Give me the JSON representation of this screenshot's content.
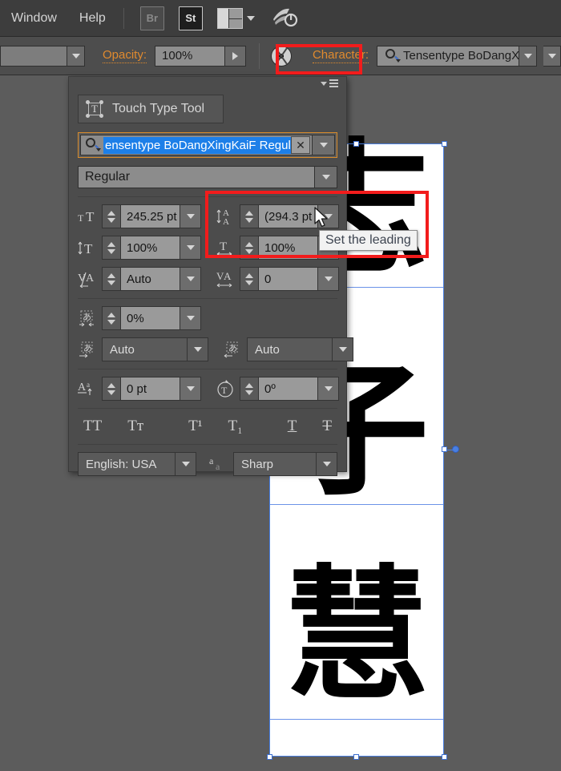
{
  "menubar": {
    "items": [
      {
        "label": "Window"
      },
      {
        "label": "Help"
      }
    ],
    "bridge_label": "Br",
    "stock_label": "St",
    "workspace_icon": "workspace-switcher-icon",
    "rocket_icon": "rocket-power-icon"
  },
  "controlbar": {
    "fill_swatch_name": "fill-color-swatch",
    "opacity_label": "Opacity:",
    "opacity_value": "100%",
    "recolor_icon": "recolor-artwork-icon",
    "character_label": "Character:",
    "font_name": "Tensentype BoDangXingK",
    "search_icon": "search-font-icon"
  },
  "character_panel": {
    "touch_type_tool": "Touch Type Tool",
    "font_search": {
      "value": "ensentype BoDangXingKaiF Regular",
      "clear_glyph": "✕",
      "icon": "search-icon"
    },
    "font_style": "Regular",
    "font_size": {
      "icon": "font-size-icon",
      "value": "245.25 pt"
    },
    "leading": {
      "icon": "leading-icon",
      "value": "(294.3 pt"
    },
    "vertical_scale": {
      "icon": "vertical-scale-icon",
      "value": "100%"
    },
    "horizontal_scale": {
      "icon": "horizontal-scale-icon",
      "value": "100%"
    },
    "kerning": {
      "icon": "kerning-icon",
      "value": "Auto"
    },
    "tracking": {
      "icon": "tracking-icon",
      "value": "0"
    },
    "tsume": {
      "icon": "tsume-icon",
      "value": "0%"
    },
    "aki_left": {
      "icon": "aki-left-icon",
      "value": "Auto"
    },
    "aki_right": {
      "icon": "aki-right-icon",
      "value": "Auto"
    },
    "baseline_shift": {
      "icon": "baseline-shift-icon",
      "value": "0 pt"
    },
    "character_rotation": {
      "icon": "character-rotation-icon",
      "value": "0º"
    },
    "case_buttons": [
      {
        "name": "all-caps-button",
        "glyph": "TT"
      },
      {
        "name": "small-caps-button",
        "glyph": "Tᴛ"
      },
      {
        "name": "superscript-button",
        "glyph": "T¹"
      },
      {
        "name": "subscript-button",
        "glyph": "T₁"
      },
      {
        "name": "underline-button",
        "glyph": "T"
      },
      {
        "name": "strikethrough-button",
        "glyph": "T"
      }
    ],
    "language": "English: USA",
    "anti_alias_icon": "anti-aliasing-icon",
    "anti_alias": "Sharp",
    "panel_menu_icon": "panel-menu-icon"
  },
  "tooltip": {
    "text": "Set the leading"
  },
  "cursor": {
    "name": "mouse-pointer"
  },
  "canvas": {
    "characters": [
      {
        "glyph": "志"
      },
      {
        "glyph": "子"
      },
      {
        "glyph": "慧"
      }
    ],
    "artboard_name": "artboard"
  },
  "colors": {
    "accent_orange": "#e08a2e",
    "annotation_red": "#f21c1c",
    "selection_blue": "#4a7fe0",
    "highlight_blue": "#1d7fe8",
    "panel_bg": "#4c4c4c",
    "canvas_bg": "#5c5c5c",
    "menubar_bg": "#3d3d3d"
  }
}
